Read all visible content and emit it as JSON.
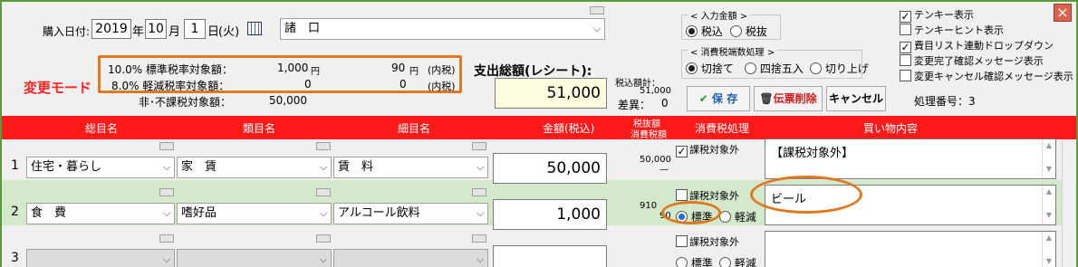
{
  "form": {
    "purchase_date_label": "購入日付:",
    "year": "2019",
    "year_unit": "年",
    "month": "10",
    "month_unit": "月",
    "day": "1",
    "day_unit": "日",
    "weekday": "(火)",
    "store": "諸　口"
  },
  "mode_label": "変更モード",
  "tax_summary": {
    "row1_label": "10.0% 標準税率対象額：",
    "row1_amount": "1,000",
    "row1_unit": "円",
    "row1_tax": "90",
    "row1_tax_unit": "円",
    "row1_note": "(内税)",
    "row2_label": "8.0% 軽減税率対象額：",
    "row2_amount": "0",
    "row2_tax": "0",
    "row2_note": "(内税)",
    "row3_label": "非･不課税対象額：",
    "row3_amount": "50,000"
  },
  "total": {
    "label": "支出総額(レシート):",
    "value": "51,000",
    "incl_label": "税込額計：",
    "incl_value": "51,000",
    "diff_label": "差異：",
    "diff_value": "0"
  },
  "input_amount": {
    "title": "< 入力金額 >",
    "opt_incl": "税込",
    "opt_excl": "税抜"
  },
  "rounding": {
    "title": "< 消費税端数処理 >",
    "opt_floor": "切捨て",
    "opt_round": "四捨五入",
    "opt_ceil": "切り上げ"
  },
  "buttons": {
    "save": "保 存",
    "delete": "伝票削除",
    "cancel": "キャンセル"
  },
  "process_no": "処理番号：3",
  "options": [
    {
      "label": "テンキー表示",
      "checked": true
    },
    {
      "label": "テンキーヒント表示",
      "checked": false
    },
    {
      "label": "費目リスト連動ドロップダウン",
      "checked": true
    },
    {
      "label": "変更完了確認メッセージ表示",
      "checked": false
    },
    {
      "label": "変更キャンセル確認メッセージ表示",
      "checked": false
    }
  ],
  "table": {
    "headers": {
      "category": "総目名",
      "class": "類目名",
      "item": "細目名",
      "amount": "金額(税込)",
      "tax_top": "税抜額",
      "tax_bottom": "消費税額",
      "tax_proc": "消費税処理",
      "content": "買い物内容"
    },
    "rows": [
      {
        "no": "1",
        "category": "住宅・暮らし",
        "class": "家　賃",
        "item": "賃　料",
        "amount": "50,000",
        "tax_a": "50,000",
        "tax_b": "—",
        "exempt_label": "課税対象外",
        "exempt": true,
        "content": "【課税対象外】"
      },
      {
        "no": "2",
        "category": "食　費",
        "class": "嗜好品",
        "item": "アルコール飲料",
        "amount": "1,000",
        "tax_a": "910",
        "tax_b": "90",
        "exempt_label": "課税対象外",
        "exempt": false,
        "std": "標準",
        "red": "軽減",
        "content": "ビール"
      },
      {
        "no": "3",
        "category": "",
        "class": "",
        "item": "",
        "amount": "",
        "exempt_label": "課税対象外",
        "exempt": false,
        "std": "標準",
        "red": "軽減",
        "content": ""
      }
    ]
  },
  "colors": {
    "header": "#ff1a1a",
    "highlight_row": "#d4e8cc",
    "annotation": "#e07820",
    "mode": "#ff2020",
    "total_bg": "#fffde0"
  }
}
